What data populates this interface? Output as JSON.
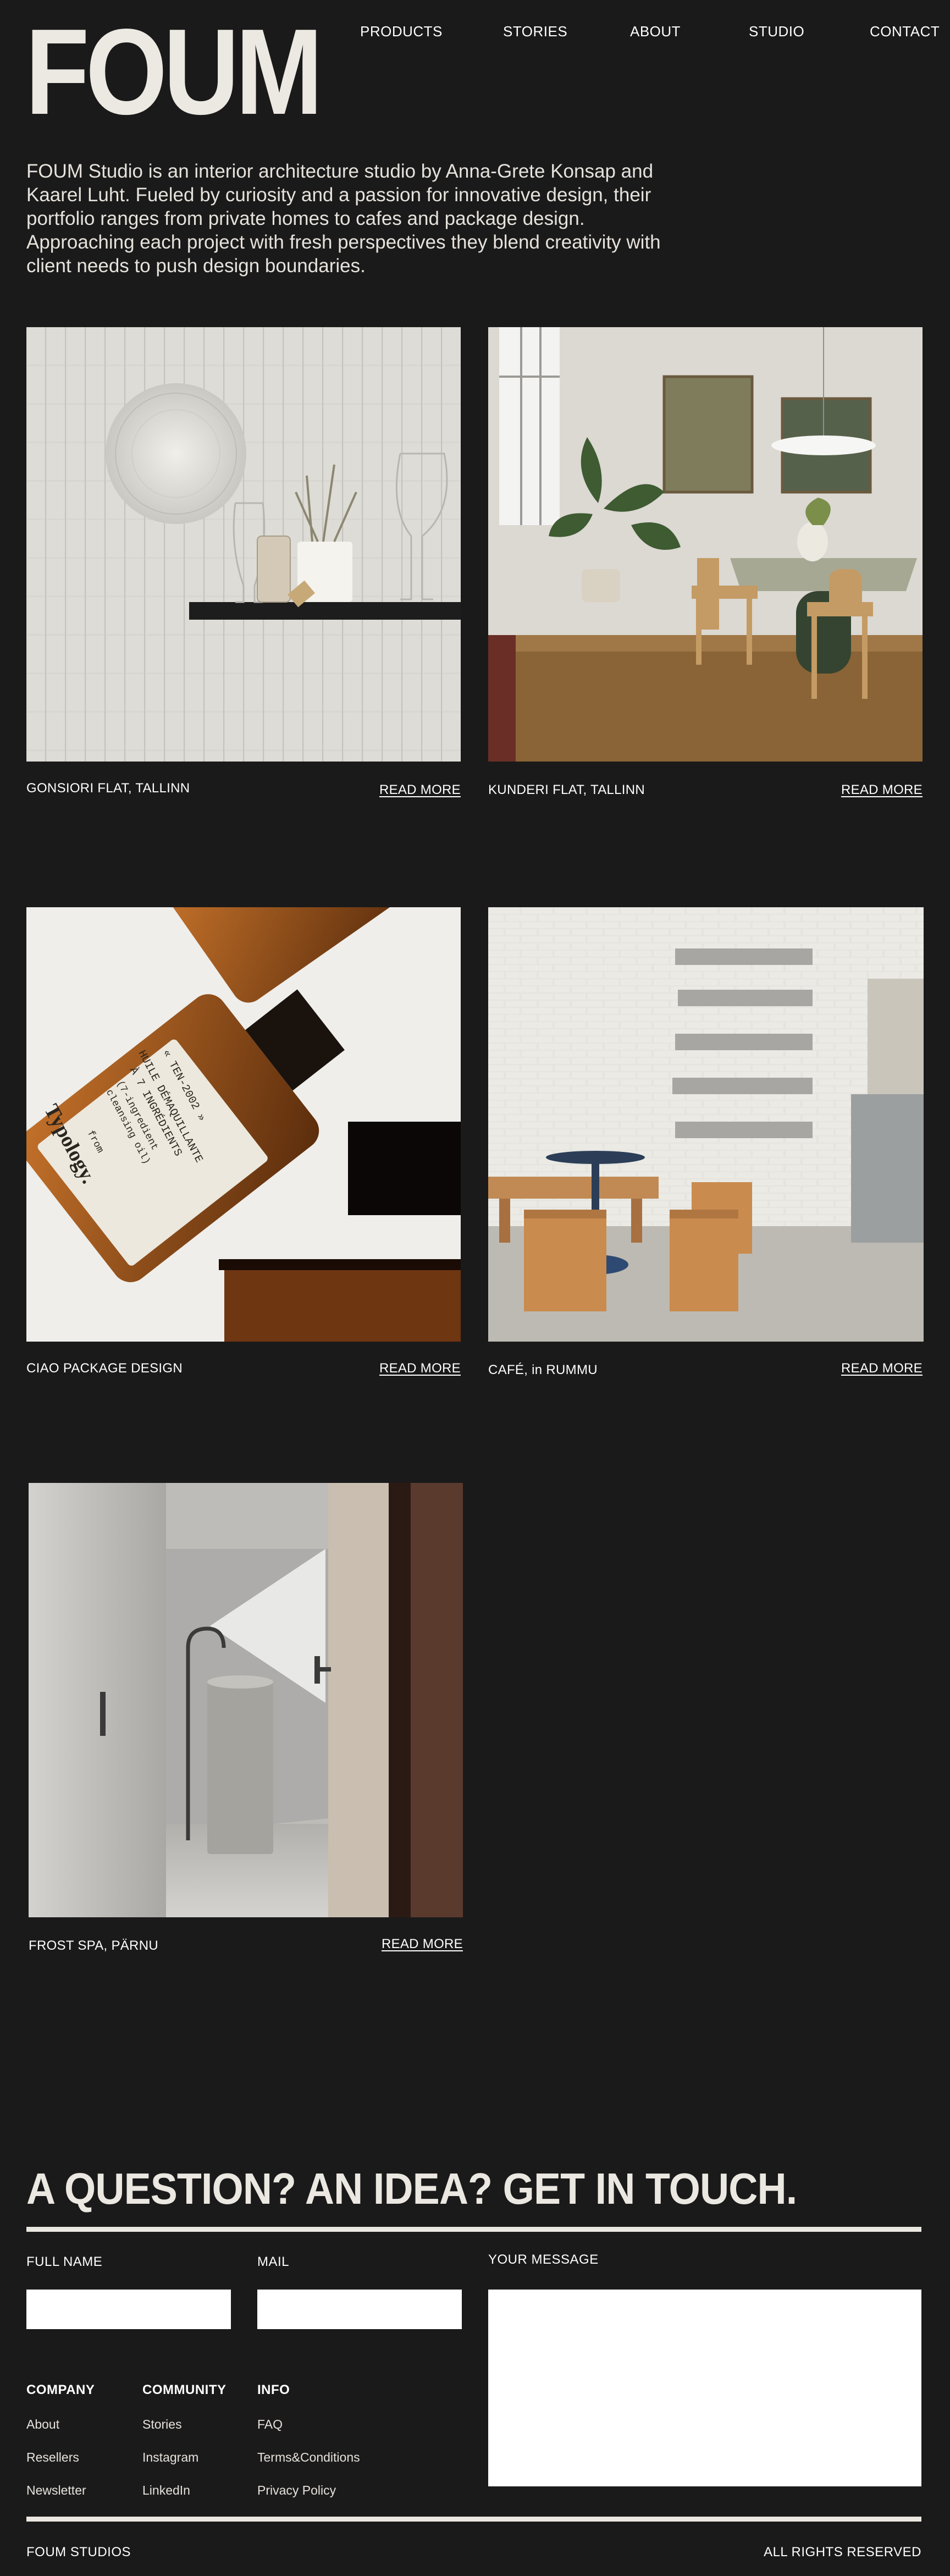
{
  "brand": {
    "logo": "FOUM"
  },
  "nav": [
    {
      "label": "PRODUCTS"
    },
    {
      "label": "STORIES"
    },
    {
      "label": "ABOUT"
    },
    {
      "label": "STUDIO"
    },
    {
      "label": "CONTACT"
    }
  ],
  "intro": "FOUM Studio is an interior architecture studio by Anna-Grete Konsap and Kaarel Luht. Fueled by curiosity and a passion for innovative design, their portfolio ranges from private homes to cafes and package design. Approaching each project with fresh perspectives they blend creativity with client needs to push design boundaries.",
  "projects": [
    {
      "title": "GONSIORI FLAT, TALLINN",
      "more": "READ MORE"
    },
    {
      "title": "KUNDERI FLAT, TALLINN",
      "more": "READ MORE"
    },
    {
      "title": "CIAO PACKAGE DESIGN",
      "more": "READ MORE"
    },
    {
      "title": "CAFÉ, in RUMMU",
      "more": "READ MORE"
    },
    {
      "title": "FROST SPA, PÄRNU",
      "more": "READ MORE"
    }
  ],
  "bottle_label": {
    "line1": "« TEN-2002 »",
    "line2": "HUILE DÉMAQUILLANTE",
    "line3": "À 7 INGRÉDIENTS",
    "line4": "(7-ingredient",
    "line5": "cleansing oil)",
    "from": "from",
    "brand": "Typology."
  },
  "contact": {
    "heading": "A QUESTION? AN IDEA? GET IN TOUCH.",
    "full_name_label": "FULL NAME",
    "mail_label": "MAIL",
    "message_label": "YOUR MESSAGE",
    "full_name_value": "",
    "mail_value": "",
    "message_value": ""
  },
  "footer": {
    "company": {
      "heading": "COMPANY",
      "links": [
        "About",
        "Resellers",
        "Newsletter"
      ]
    },
    "community": {
      "heading": "COMMUNITY",
      "links": [
        "Stories",
        "Instagram",
        "LinkedIn"
      ]
    },
    "info": {
      "heading": "INFO",
      "links": [
        "FAQ",
        "Terms&Conditions",
        "Privacy Policy"
      ]
    },
    "left": "FOUM STUDIOS",
    "right": "ALL RIGHTS RESERVED"
  }
}
